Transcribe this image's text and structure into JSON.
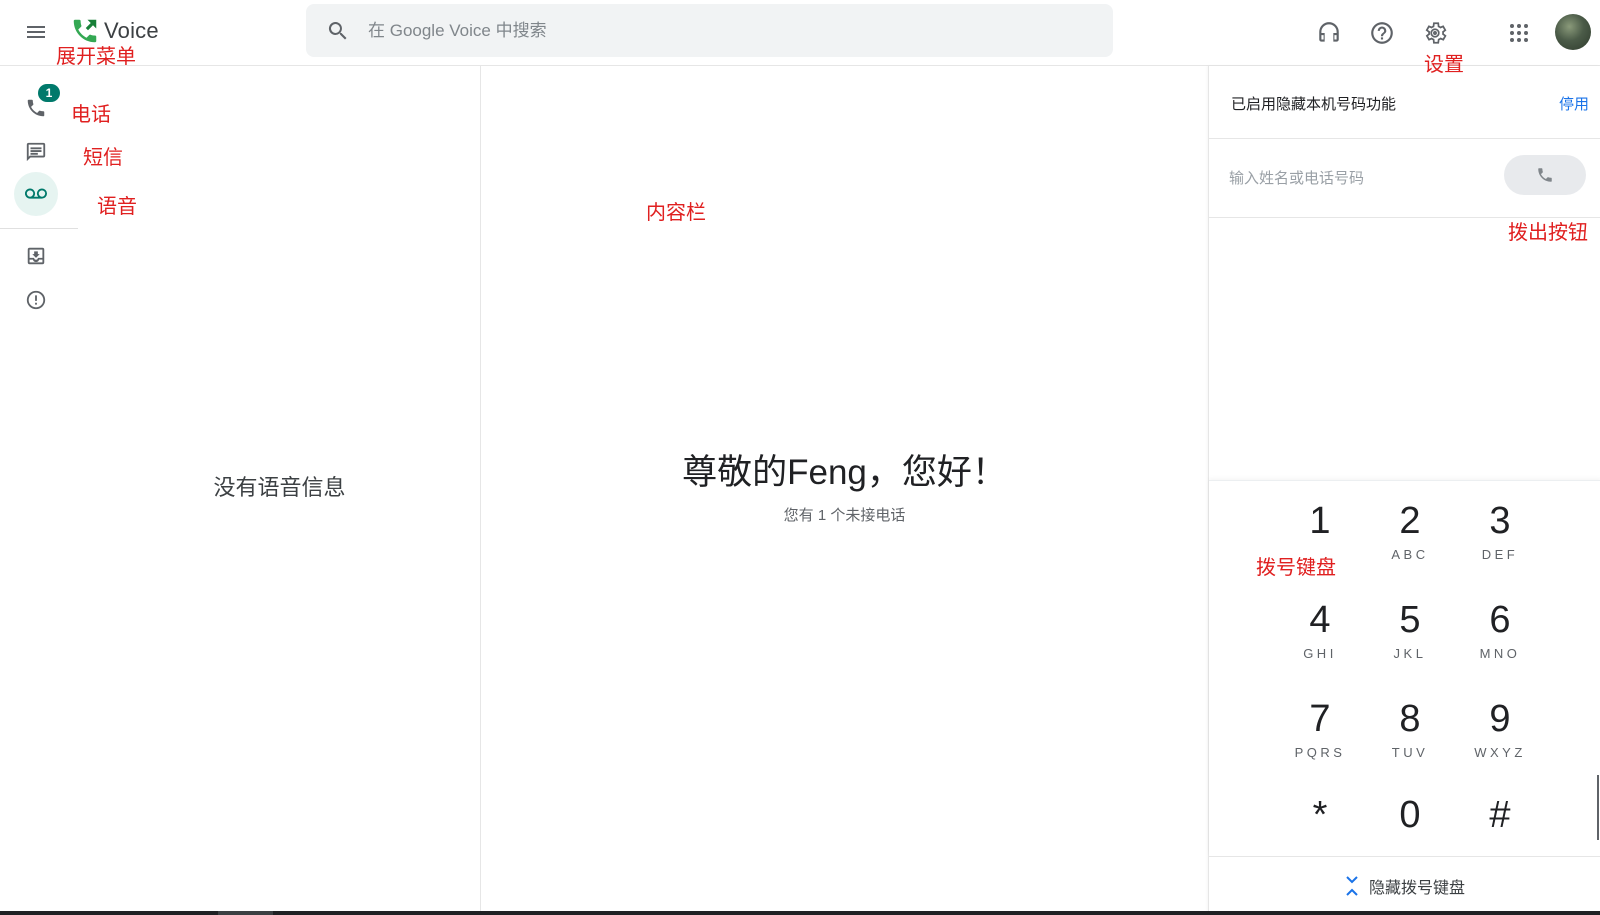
{
  "app": {
    "logo_text": "Voice"
  },
  "search": {
    "placeholder": "在 Google Voice 中搜索"
  },
  "header_icons": [
    "menu-icon",
    "support-headset-icon",
    "help-icon",
    "settings-gear-icon",
    "apps-grid-icon"
  ],
  "nav": {
    "items": [
      {
        "name": "calls",
        "icon": "phone-icon",
        "badge": "1"
      },
      {
        "name": "messages",
        "icon": "message-icon"
      },
      {
        "name": "voicemail",
        "icon": "voicemail-icon",
        "active": true
      },
      {
        "name": "archive",
        "icon": "archive-icon"
      },
      {
        "name": "spam",
        "icon": "spam-icon"
      }
    ]
  },
  "list": {
    "empty_message": "没有语音信息"
  },
  "content": {
    "greeting": "尊敬的Feng，您好！",
    "missed_calls": "您有 1 个未接电话"
  },
  "dialer": {
    "hide_number_text": "已启用隐藏本机号码功能",
    "disable_link": "停用",
    "input_placeholder": "输入姓名或电话号码",
    "keys": [
      {
        "digit": "1",
        "letters": ""
      },
      {
        "digit": "2",
        "letters": "ABC"
      },
      {
        "digit": "3",
        "letters": "DEF"
      },
      {
        "digit": "4",
        "letters": "GHI"
      },
      {
        "digit": "5",
        "letters": "JKL"
      },
      {
        "digit": "6",
        "letters": "MNO"
      },
      {
        "digit": "7",
        "letters": "PQRS"
      },
      {
        "digit": "8",
        "letters": "TUV"
      },
      {
        "digit": "9",
        "letters": "WXYZ"
      },
      {
        "digit": "*",
        "letters": ""
      },
      {
        "digit": "0",
        "letters": ""
      },
      {
        "digit": "#",
        "letters": ""
      }
    ],
    "hide_keypad_label": "隐藏拨号键盘"
  },
  "annotations": {
    "expand_menu": "展开菜单",
    "settings": "设置",
    "calls": "电话",
    "messages": "短信",
    "voicemail": "语音",
    "content_pane": "内容栏",
    "dial_button": "拨出按钮",
    "keypad": "拨号键盘"
  },
  "colors": {
    "accent_teal": "#00796b",
    "link_blue": "#1a73e8",
    "annotation_red": "#e02020",
    "search_bg": "#f1f3f4"
  }
}
